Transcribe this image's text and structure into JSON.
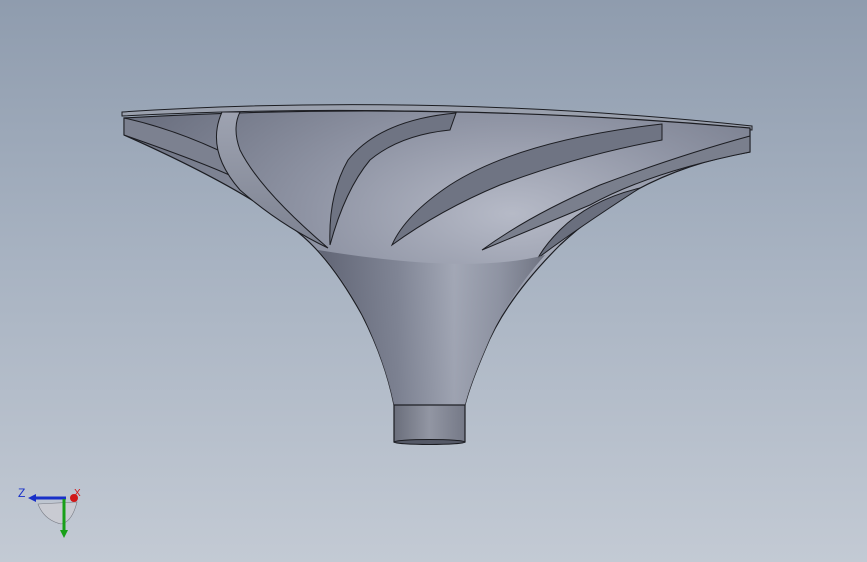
{
  "viewport": {
    "background_top": "#8f9cae",
    "background_bottom": "#c3cad4"
  },
  "model": {
    "kind": "impeller-3d-model",
    "body_color": "#8a8f9f",
    "edge_color": "#1c1d22"
  },
  "triad": {
    "z_label": "Z",
    "x_label": "X",
    "z_color": "#1830c8",
    "x_color": "#d01818",
    "y_color": "#18a018"
  }
}
